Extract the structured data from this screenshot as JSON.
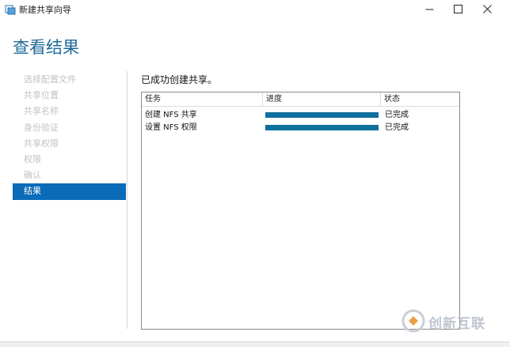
{
  "window": {
    "title": "新建共享向导",
    "controls": [
      "minimize-icon",
      "maximize-icon",
      "close-icon"
    ]
  },
  "page": {
    "heading": "查看结果"
  },
  "steps": [
    {
      "label": "选择配置文件",
      "active": false
    },
    {
      "label": "共享位置",
      "active": false
    },
    {
      "label": "共享名称",
      "active": false
    },
    {
      "label": "身份验证",
      "active": false
    },
    {
      "label": "共享权限",
      "active": false
    },
    {
      "label": "权限",
      "active": false
    },
    {
      "label": "确认",
      "active": false
    },
    {
      "label": "结果",
      "active": true
    }
  ],
  "content": {
    "message": "已成功创建共享。",
    "table": {
      "columns": [
        "任务",
        "进度",
        "状态"
      ],
      "rows": [
        {
          "task": "创建 NFS 共享",
          "progress": 1.0,
          "status": "已完成"
        },
        {
          "task": "设置 NFS 权限",
          "progress": 1.0,
          "status": "已完成"
        }
      ]
    }
  },
  "watermark": {
    "text": "创新互联"
  },
  "colors": {
    "heading": "#1f6b98",
    "active_step": "#0a6bb8",
    "progress_fill": "#0f6f9d",
    "inactive_step": "#c2c2c2"
  }
}
